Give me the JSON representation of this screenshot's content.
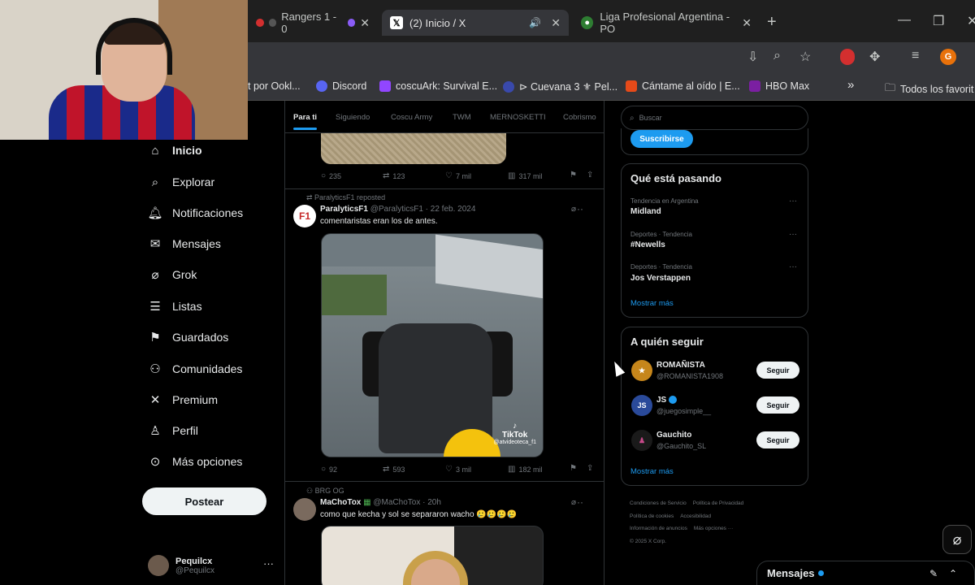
{
  "browser": {
    "tabs": [
      {
        "label": "Rangers 1 - 0"
      },
      {
        "label": "(2) Inicio / X"
      },
      {
        "label": "Liga Profesional Argentina - PO"
      }
    ],
    "bookmarks": [
      {
        "label": "t por Ookl..."
      },
      {
        "label": "Discord"
      },
      {
        "label": "coscuArk: Survival E..."
      },
      {
        "label": "⊳ Cuevana 3 ⚜ Pel..."
      },
      {
        "label": "Cántame al oído | E..."
      },
      {
        "label": "HBO Max"
      },
      {
        "label": "Todos los favorit"
      }
    ],
    "profile_initial": "G",
    "more_glyph": "»"
  },
  "nav": {
    "items": [
      {
        "label": "Inicio",
        "icon": "home-icon"
      },
      {
        "label": "Explorar",
        "icon": "search-icon"
      },
      {
        "label": "Notificaciones",
        "icon": "bell-icon"
      },
      {
        "label": "Mensajes",
        "icon": "envelope-icon"
      },
      {
        "label": "Grok",
        "icon": "grok-icon"
      },
      {
        "label": "Listas",
        "icon": "list-icon"
      },
      {
        "label": "Guardados",
        "icon": "bookmark-icon"
      },
      {
        "label": "Comunidades",
        "icon": "people-icon"
      },
      {
        "label": "Premium",
        "icon": "x-logo-icon"
      },
      {
        "label": "Perfil",
        "icon": "person-icon"
      },
      {
        "label": "Más opciones",
        "icon": "more-circle-icon"
      }
    ],
    "post_button": "Postear",
    "user": {
      "name": "Pequilcx",
      "handle": "@Pequilcx"
    }
  },
  "timeline": {
    "tabs": [
      "Para ti",
      "Siguiendo",
      "Coscu Army",
      "TWM",
      "MERNOSKETTI",
      "Cobrismo"
    ],
    "post0_stats": {
      "replies": "235",
      "reposts": "123",
      "likes": "7 mil",
      "views": "317 mil"
    },
    "post1": {
      "repost_label": "ParalyticsF1 reposted",
      "name": "ParalyticsF1",
      "handle_date": "@ParalyticsF1 · 22 feb. 2024",
      "text": "comentaristas eran los de antes.",
      "media_badge": "TikTok",
      "media_handle": "@atvideoteca_f1",
      "stats": {
        "replies": "92",
        "reposts": "593",
        "likes": "3 mil",
        "views": "182 mil"
      }
    },
    "post2": {
      "repost_label": "BRG OG",
      "name": "MaChoTox",
      "handle_date": "@MaChoTox · 20h",
      "text": "como que kecha y sol se separaron wacho 🥲🥲🥲🥲"
    }
  },
  "right": {
    "search_placeholder": "Buscar",
    "subscribe_button": "Suscribirse",
    "trends_title": "Qué está pasando",
    "trends": [
      {
        "category": "Tendencia en Argentina",
        "name": "Midland"
      },
      {
        "category": "Deportes · Tendencia",
        "name": "#Newells"
      },
      {
        "category": "Deportes · Tendencia",
        "name": "Jos Verstappen"
      }
    ],
    "trends_more": "Mostrar más",
    "follow_title": "A quién seguir",
    "follow": [
      {
        "name": "ROMAÑISTA",
        "handle": "@ROMANISTA1908",
        "button": "Seguir",
        "color": "#c6861b"
      },
      {
        "name": "JS",
        "handle": "@juegosimple__",
        "button": "Seguir",
        "color": "#2a4a9a"
      },
      {
        "name": "Gauchito",
        "handle": "@Gauchito_SL",
        "button": "Seguir",
        "color": "#1a1a1a"
      }
    ],
    "follow_more": "Mostrar más",
    "footer": [
      "Condiciones de Servicio",
      "Política de Privacidad",
      "Política de cookies",
      "Accesibilidad",
      "Información de anuncios",
      "Más opciones ···",
      "© 2025 X Corp."
    ]
  },
  "messages_drawer": {
    "label": "Mensajes"
  },
  "colors": {
    "accent": "#1d9bf0",
    "background": "#000000",
    "border": "#2f3336",
    "muted": "#71767b"
  }
}
